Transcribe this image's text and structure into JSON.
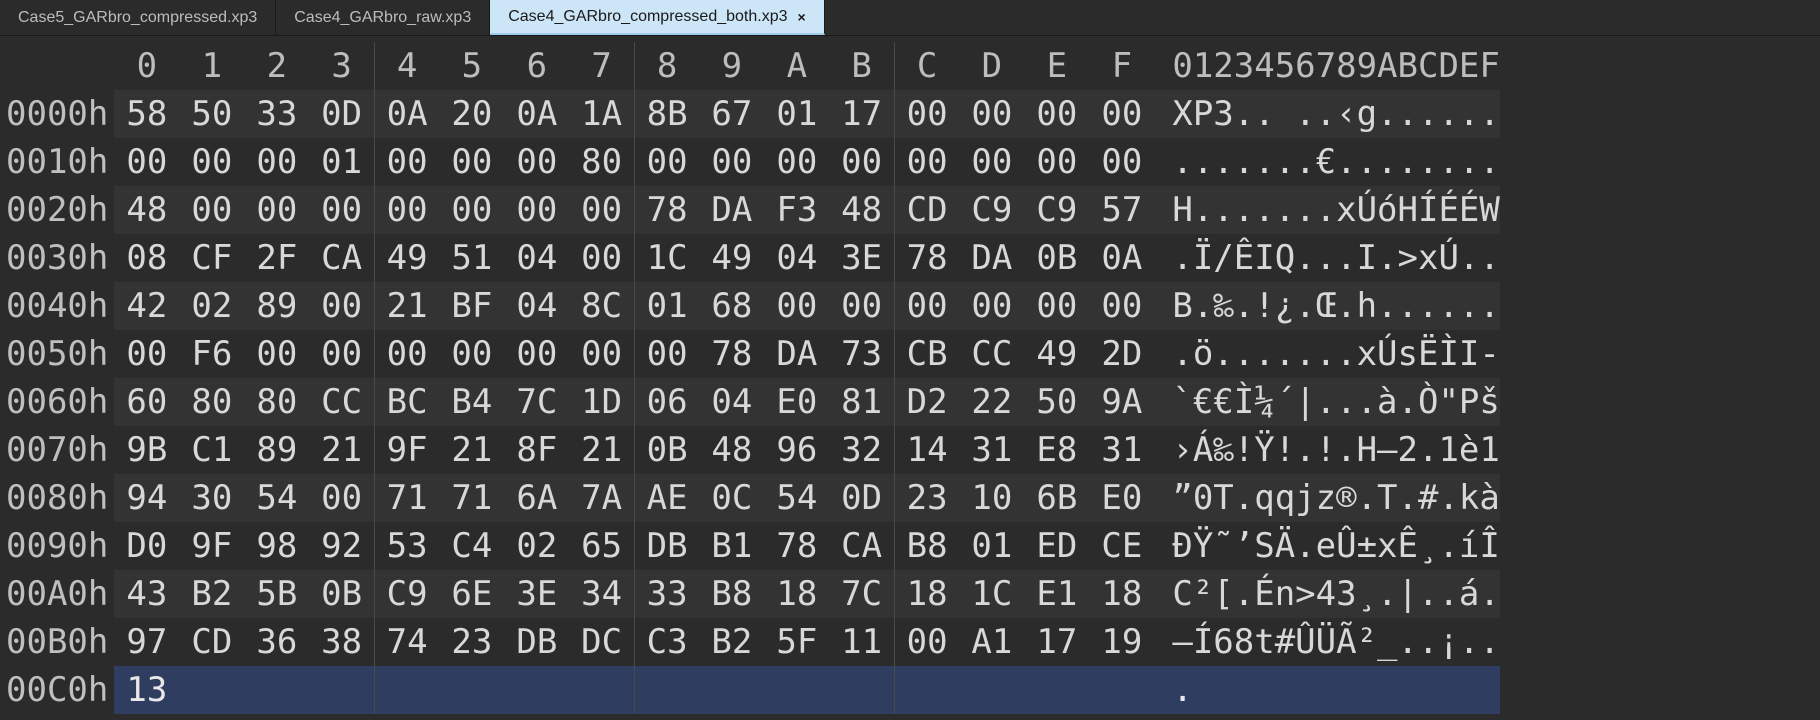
{
  "tabs": [
    {
      "label": "Case5_GARbro_compressed.xp3",
      "active": false,
      "closeShown": false
    },
    {
      "label": "Case4_GARbro_raw.xp3",
      "active": false,
      "closeShown": false
    },
    {
      "label": "Case4_GARbro_compressed_both.xp3",
      "active": true,
      "closeShown": true
    }
  ],
  "closeGlyph": "×",
  "hexHeader": {
    "bytes": [
      "0",
      "1",
      "2",
      "3",
      "4",
      "5",
      "6",
      "7",
      "8",
      "9",
      "A",
      "B",
      "C",
      "D",
      "E",
      "F"
    ],
    "ascii": "0123456789ABCDEF"
  },
  "selectedRowOffset": "00C0h",
  "rows": [
    {
      "offset": "0000h",
      "bytes": [
        "58",
        "50",
        "33",
        "0D",
        "0A",
        "20",
        "0A",
        "1A",
        "8B",
        "67",
        "01",
        "17",
        "00",
        "00",
        "00",
        "00"
      ],
      "ascii": "XP3.. ..‹g......"
    },
    {
      "offset": "0010h",
      "bytes": [
        "00",
        "00",
        "00",
        "01",
        "00",
        "00",
        "00",
        "80",
        "00",
        "00",
        "00",
        "00",
        "00",
        "00",
        "00",
        "00"
      ],
      "ascii": ".......€........"
    },
    {
      "offset": "0020h",
      "bytes": [
        "48",
        "00",
        "00",
        "00",
        "00",
        "00",
        "00",
        "00",
        "78",
        "DA",
        "F3",
        "48",
        "CD",
        "C9",
        "C9",
        "57"
      ],
      "ascii": "H.......xÚóHÍÉÉW"
    },
    {
      "offset": "0030h",
      "bytes": [
        "08",
        "CF",
        "2F",
        "CA",
        "49",
        "51",
        "04",
        "00",
        "1C",
        "49",
        "04",
        "3E",
        "78",
        "DA",
        "0B",
        "0A"
      ],
      "ascii": ".Ï/ÊIQ...I.>xÚ.."
    },
    {
      "offset": "0040h",
      "bytes": [
        "42",
        "02",
        "89",
        "00",
        "21",
        "BF",
        "04",
        "8C",
        "01",
        "68",
        "00",
        "00",
        "00",
        "00",
        "00",
        "00"
      ],
      "ascii": "B.‰.!¿.Œ.h......"
    },
    {
      "offset": "0050h",
      "bytes": [
        "00",
        "F6",
        "00",
        "00",
        "00",
        "00",
        "00",
        "00",
        "00",
        "78",
        "DA",
        "73",
        "CB",
        "CC",
        "49",
        "2D"
      ],
      "ascii": ".ö.......xÚsËÌI-"
    },
    {
      "offset": "0060h",
      "bytes": [
        "60",
        "80",
        "80",
        "CC",
        "BC",
        "B4",
        "7C",
        "1D",
        "06",
        "04",
        "E0",
        "81",
        "D2",
        "22",
        "50",
        "9A"
      ],
      "ascii": "`€€Ì¼´|...à.Ò\"Pš"
    },
    {
      "offset": "0070h",
      "bytes": [
        "9B",
        "C1",
        "89",
        "21",
        "9F",
        "21",
        "8F",
        "21",
        "0B",
        "48",
        "96",
        "32",
        "14",
        "31",
        "E8",
        "31"
      ],
      "ascii": "›Á‰!Ÿ!.!.H–2.1è1"
    },
    {
      "offset": "0080h",
      "bytes": [
        "94",
        "30",
        "54",
        "00",
        "71",
        "71",
        "6A",
        "7A",
        "AE",
        "0C",
        "54",
        "0D",
        "23",
        "10",
        "6B",
        "E0"
      ],
      "ascii": "”0T.qqjz®.T.#.kà"
    },
    {
      "offset": "0090h",
      "bytes": [
        "D0",
        "9F",
        "98",
        "92",
        "53",
        "C4",
        "02",
        "65",
        "DB",
        "B1",
        "78",
        "CA",
        "B8",
        "01",
        "ED",
        "CE"
      ],
      "ascii": "ÐŸ˜’SÄ.eÛ±xÊ¸.íÎ"
    },
    {
      "offset": "00A0h",
      "bytes": [
        "43",
        "B2",
        "5B",
        "0B",
        "C9",
        "6E",
        "3E",
        "34",
        "33",
        "B8",
        "18",
        "7C",
        "18",
        "1C",
        "E1",
        "18"
      ],
      "ascii": "C²[.Én>43¸.|..á."
    },
    {
      "offset": "00B0h",
      "bytes": [
        "97",
        "CD",
        "36",
        "38",
        "74",
        "23",
        "DB",
        "DC",
        "C3",
        "B2",
        "5F",
        "11",
        "00",
        "A1",
        "17",
        "19"
      ],
      "ascii": "—Í68t#ÛÜÃ²_..¡.."
    },
    {
      "offset": "00C0h",
      "bytes": [
        "13",
        "",
        "",
        "",
        "",
        "",
        "",
        "",
        "",
        "",
        "",
        "",
        "",
        "",
        "",
        ""
      ],
      "ascii": ".               "
    }
  ]
}
